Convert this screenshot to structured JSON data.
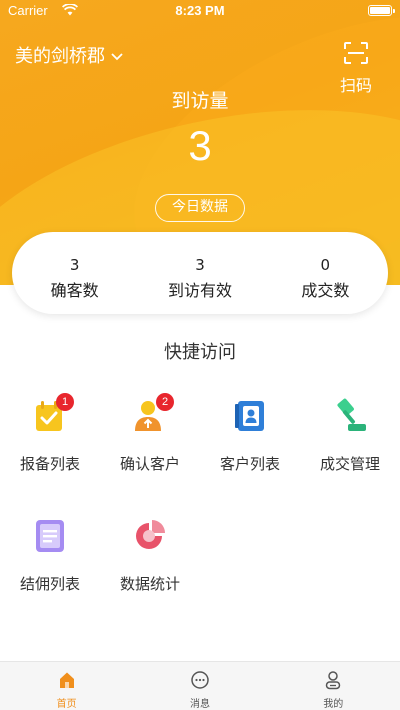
{
  "status_bar": {
    "carrier": "Carrier",
    "time": "8:23 PM"
  },
  "header": {
    "project_name": "美的剑桥郡",
    "scan_label": "扫码",
    "visit_title": "到访量",
    "visit_count": "3",
    "today_label": "今日数据"
  },
  "stats": [
    {
      "value": "3",
      "label": "确客数"
    },
    {
      "value": "3",
      "label": "到访有效"
    },
    {
      "value": "0",
      "label": "成交数"
    }
  ],
  "quick_access": {
    "title": "快捷访问",
    "items": [
      {
        "label": "报备列表",
        "badge": "1",
        "icon": "report-list-icon"
      },
      {
        "label": "确认客户",
        "badge": "2",
        "icon": "confirm-customer-icon"
      },
      {
        "label": "客户列表",
        "badge": "",
        "icon": "customer-list-icon"
      },
      {
        "label": "成交管理",
        "badge": "",
        "icon": "deal-management-icon"
      },
      {
        "label": "结佣列表",
        "badge": "",
        "icon": "commission-list-icon"
      },
      {
        "label": "数据统计",
        "badge": "",
        "icon": "data-statistics-icon"
      }
    ]
  },
  "tabbar": {
    "items": [
      {
        "label": "首页",
        "icon": "home-icon",
        "active": true
      },
      {
        "label": "消息",
        "icon": "message-icon",
        "active": false
      },
      {
        "label": "我的",
        "icon": "profile-icon",
        "active": false
      }
    ]
  },
  "colors": {
    "accent": "#f5a516",
    "badge": "#e8262d",
    "active_tab": "#f08f1c"
  }
}
